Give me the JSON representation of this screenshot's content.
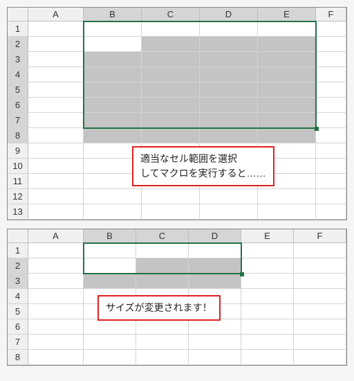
{
  "sheet1": {
    "columns": [
      "A",
      "B",
      "C",
      "D",
      "E",
      "F"
    ],
    "rows": [
      "1",
      "2",
      "3",
      "4",
      "5",
      "6",
      "7",
      "8",
      "9",
      "10",
      "11",
      "12",
      "13"
    ],
    "selection": {
      "startCol": 2,
      "endCol": 5,
      "startRow": 2,
      "endRow": 8
    },
    "callout": "適当なセル範囲を選択\nしてマクロを実行すると……"
  },
  "sheet2": {
    "columns": [
      "A",
      "B",
      "C",
      "D",
      "E",
      "F"
    ],
    "rows": [
      "1",
      "2",
      "3",
      "4",
      "5",
      "6",
      "7",
      "8"
    ],
    "selection": {
      "startCol": 2,
      "endCol": 4,
      "startRow": 2,
      "endRow": 3
    },
    "callout": "サイズが変更されます！"
  },
  "chart_data": null
}
